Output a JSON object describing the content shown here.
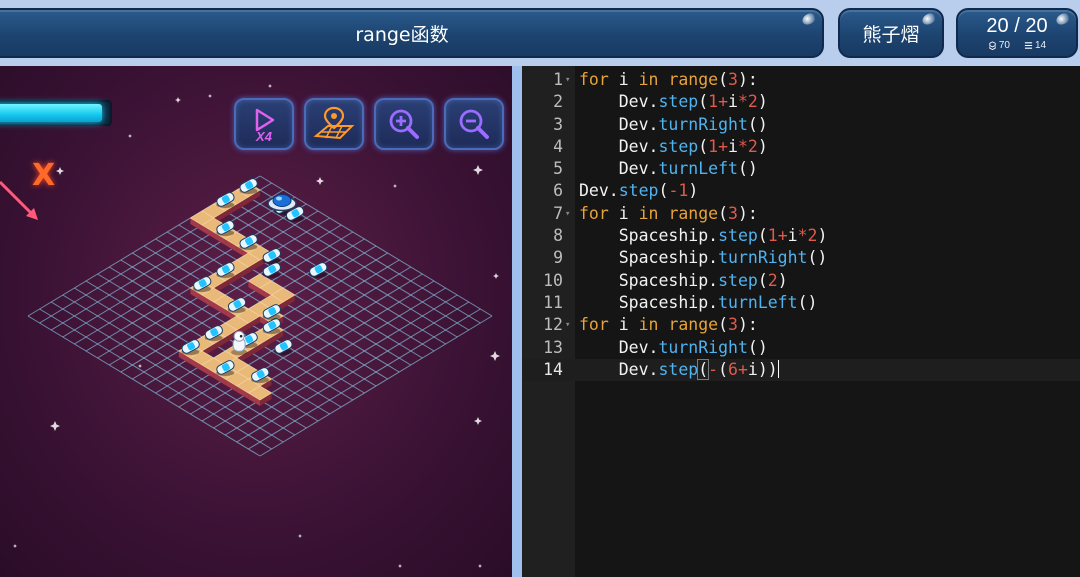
{
  "header": {
    "title": "range函数",
    "player_name": "熊子熠",
    "level_progress": "20 / 20",
    "stat_left": "70",
    "stat_right": "14",
    "stat_left_icon": "cubes-icon",
    "stat_right_icon": "lines-icon"
  },
  "game": {
    "energy_fraction": 0.93,
    "marker": "X",
    "toolbar": [
      {
        "name": "speed-x4-button",
        "icon": "play-speed-icon",
        "label": "X4"
      },
      {
        "name": "map-button",
        "icon": "map-pin-icon"
      },
      {
        "name": "zoom-in-button",
        "icon": "zoom-in-icon"
      },
      {
        "name": "zoom-out-button",
        "icon": "zoom-out-icon"
      }
    ],
    "colors": {
      "background": "#3d1336",
      "grid": "#7fb4d2",
      "tile": "#e9b97a",
      "energy": "#14c8ee",
      "toolbar_border": "#4b6bb8"
    }
  },
  "editor": {
    "lines": [
      {
        "num": "1",
        "fold": true,
        "tokens": [
          [
            "kw",
            "for"
          ],
          [
            "t",
            " i "
          ],
          [
            "kw",
            "in"
          ],
          [
            "t",
            " "
          ],
          [
            "kw",
            "range"
          ],
          [
            "t",
            "("
          ],
          [
            "num",
            "3"
          ],
          [
            "t",
            "):"
          ]
        ]
      },
      {
        "num": "2",
        "fold": false,
        "tokens": [
          [
            "t",
            "    Dev."
          ],
          [
            "fn",
            "step"
          ],
          [
            "t",
            "("
          ],
          [
            "num",
            "1"
          ],
          [
            "op",
            "+"
          ],
          [
            "t",
            "i"
          ],
          [
            "op",
            "*"
          ],
          [
            "num",
            "2"
          ],
          [
            "t",
            ")"
          ]
        ]
      },
      {
        "num": "3",
        "fold": false,
        "tokens": [
          [
            "t",
            "    Dev."
          ],
          [
            "fn",
            "turnRight"
          ],
          [
            "t",
            "()"
          ]
        ]
      },
      {
        "num": "4",
        "fold": false,
        "tokens": [
          [
            "t",
            "    Dev."
          ],
          [
            "fn",
            "step"
          ],
          [
            "t",
            "("
          ],
          [
            "num",
            "1"
          ],
          [
            "op",
            "+"
          ],
          [
            "t",
            "i"
          ],
          [
            "op",
            "*"
          ],
          [
            "num",
            "2"
          ],
          [
            "t",
            ")"
          ]
        ]
      },
      {
        "num": "5",
        "fold": false,
        "tokens": [
          [
            "t",
            "    Dev."
          ],
          [
            "fn",
            "turnLeft"
          ],
          [
            "t",
            "()"
          ]
        ]
      },
      {
        "num": "6",
        "fold": false,
        "tokens": [
          [
            "t",
            "Dev."
          ],
          [
            "fn",
            "step"
          ],
          [
            "t",
            "("
          ],
          [
            "op",
            "-"
          ],
          [
            "num",
            "1"
          ],
          [
            "t",
            ")"
          ]
        ]
      },
      {
        "num": "7",
        "fold": true,
        "tokens": [
          [
            "kw",
            "for"
          ],
          [
            "t",
            " i "
          ],
          [
            "kw",
            "in"
          ],
          [
            "t",
            " "
          ],
          [
            "kw",
            "range"
          ],
          [
            "t",
            "("
          ],
          [
            "num",
            "3"
          ],
          [
            "t",
            "):"
          ]
        ]
      },
      {
        "num": "8",
        "fold": false,
        "tokens": [
          [
            "t",
            "    Spaceship."
          ],
          [
            "fn",
            "step"
          ],
          [
            "t",
            "("
          ],
          [
            "num",
            "1"
          ],
          [
            "op",
            "+"
          ],
          [
            "t",
            "i"
          ],
          [
            "op",
            "*"
          ],
          [
            "num",
            "2"
          ],
          [
            "t",
            ")"
          ]
        ]
      },
      {
        "num": "9",
        "fold": false,
        "tokens": [
          [
            "t",
            "    Spaceship."
          ],
          [
            "fn",
            "turnRight"
          ],
          [
            "t",
            "()"
          ]
        ]
      },
      {
        "num": "10",
        "fold": false,
        "tokens": [
          [
            "t",
            "    Spaceship."
          ],
          [
            "fn",
            "step"
          ],
          [
            "t",
            "("
          ],
          [
            "num",
            "2"
          ],
          [
            "t",
            ")"
          ]
        ]
      },
      {
        "num": "11",
        "fold": false,
        "tokens": [
          [
            "t",
            "    Spaceship."
          ],
          [
            "fn",
            "turnLeft"
          ],
          [
            "t",
            "()"
          ]
        ]
      },
      {
        "num": "12",
        "fold": true,
        "tokens": [
          [
            "kw",
            "for"
          ],
          [
            "t",
            " i "
          ],
          [
            "kw",
            "in"
          ],
          [
            "t",
            " "
          ],
          [
            "kw",
            "range"
          ],
          [
            "t",
            "("
          ],
          [
            "num",
            "3"
          ],
          [
            "t",
            "):"
          ]
        ]
      },
      {
        "num": "13",
        "fold": false,
        "tokens": [
          [
            "t",
            "    Dev."
          ],
          [
            "fn",
            "turnRight"
          ],
          [
            "t",
            "()"
          ]
        ]
      },
      {
        "num": "14",
        "fold": false,
        "active": true,
        "tokens": [
          [
            "t",
            "    Dev."
          ],
          [
            "fn",
            "step"
          ],
          [
            "hl",
            "("
          ],
          [
            "op",
            "-"
          ],
          [
            "t",
            "("
          ],
          [
            "num",
            "6"
          ],
          [
            "op",
            "+"
          ],
          [
            "t",
            "i"
          ],
          [
            "t",
            "))"
          ],
          [
            "cursor",
            ""
          ]
        ]
      }
    ]
  }
}
